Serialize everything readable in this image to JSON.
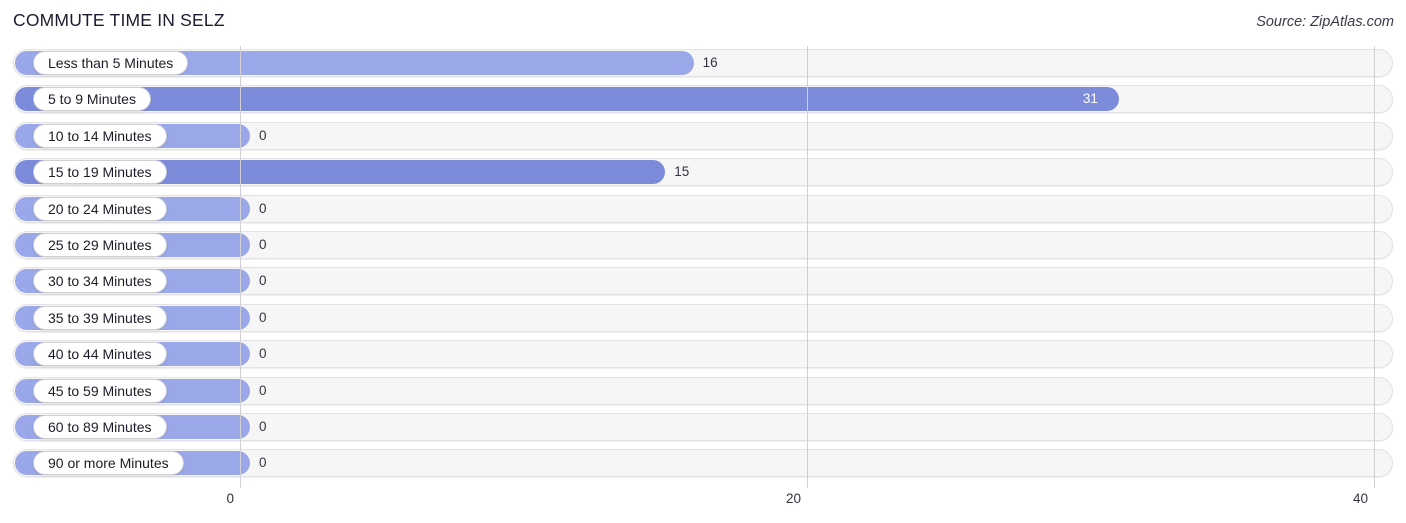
{
  "header": {
    "title": "COMMUTE TIME IN SELZ",
    "source": "Source: ZipAtlas.com"
  },
  "colors": {
    "bar_light": "#9aa7e8",
    "bar_dark": "#7c8cdb",
    "track_bg": "#f6f6f7",
    "track_border": "#e3e3e6",
    "gridline": "#cfcfd4",
    "title_text": "#1c1c30",
    "value_text": "#33333f",
    "value_text_inside": "#ffffff"
  },
  "chart_data": {
    "type": "bar",
    "orientation": "horizontal",
    "title": "COMMUTE TIME IN SELZ",
    "subtitle": "",
    "xlabel": "",
    "ylabel": "",
    "xlim": [
      0,
      40
    ],
    "xticks": [
      0,
      20,
      40
    ],
    "xtick_labels": [
      "0",
      "20",
      "40"
    ],
    "grid": true,
    "legend": false,
    "source": "Source: ZipAtlas.com",
    "categories": [
      "Less than 5 Minutes",
      "5 to 9 Minutes",
      "10 to 14 Minutes",
      "15 to 19 Minutes",
      "20 to 24 Minutes",
      "25 to 29 Minutes",
      "30 to 34 Minutes",
      "35 to 39 Minutes",
      "40 to 44 Minutes",
      "45 to 59 Minutes",
      "60 to 89 Minutes",
      "90 or more Minutes"
    ],
    "values": [
      16,
      31,
      0,
      15,
      0,
      0,
      0,
      0,
      0,
      0,
      0,
      0
    ],
    "value_labels": [
      "16",
      "31",
      "0",
      "15",
      "0",
      "0",
      "0",
      "0",
      "0",
      "0",
      "0",
      "0"
    ]
  },
  "rows": [
    {
      "label": "Less than 5 Minutes",
      "value": 16,
      "value_label": "16",
      "shade": "light",
      "label_inside": false
    },
    {
      "label": "5 to 9 Minutes",
      "value": 31,
      "value_label": "31",
      "shade": "dark",
      "label_inside": true
    },
    {
      "label": "10 to 14 Minutes",
      "value": 0,
      "value_label": "0",
      "shade": "light",
      "label_inside": false
    },
    {
      "label": "15 to 19 Minutes",
      "value": 15,
      "value_label": "15",
      "shade": "dark",
      "label_inside": false
    },
    {
      "label": "20 to 24 Minutes",
      "value": 0,
      "value_label": "0",
      "shade": "light",
      "label_inside": false
    },
    {
      "label": "25 to 29 Minutes",
      "value": 0,
      "value_label": "0",
      "shade": "light",
      "label_inside": false
    },
    {
      "label": "30 to 34 Minutes",
      "value": 0,
      "value_label": "0",
      "shade": "light",
      "label_inside": false
    },
    {
      "label": "35 to 39 Minutes",
      "value": 0,
      "value_label": "0",
      "shade": "light",
      "label_inside": false
    },
    {
      "label": "40 to 44 Minutes",
      "value": 0,
      "value_label": "0",
      "shade": "light",
      "label_inside": false
    },
    {
      "label": "45 to 59 Minutes",
      "value": 0,
      "value_label": "0",
      "shade": "light",
      "label_inside": false
    },
    {
      "label": "60 to 89 Minutes",
      "value": 0,
      "value_label": "0",
      "shade": "light",
      "label_inside": false
    },
    {
      "label": "90 or more Minutes",
      "value": 0,
      "value_label": "0",
      "shade": "light",
      "label_inside": false
    }
  ],
  "axis": {
    "ticks": [
      {
        "label": "0",
        "value": 0
      },
      {
        "label": "20",
        "value": 20
      },
      {
        "label": "40",
        "value": 40
      }
    ]
  },
  "geometry": {
    "axis_x0": 240,
    "axis_x40": 1374,
    "zero_bar_end": 250,
    "bar_start": 15
  }
}
